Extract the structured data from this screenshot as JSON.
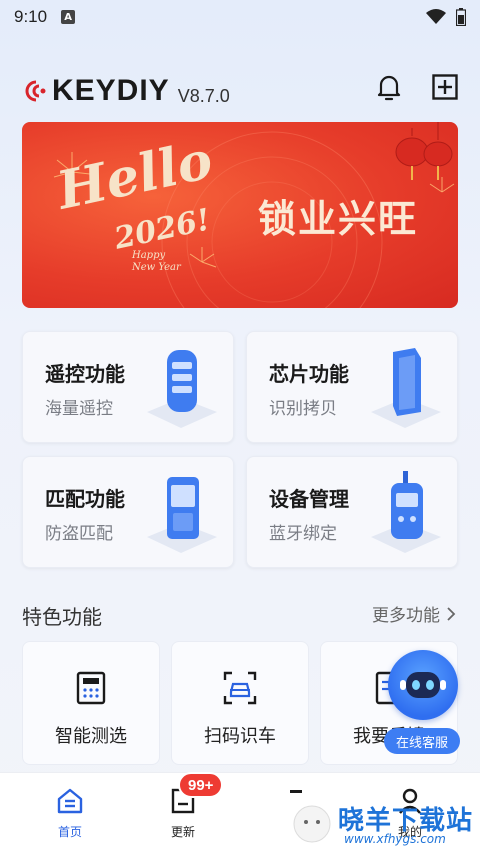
{
  "status_bar": {
    "time": "9:10",
    "notification_glyph": "A"
  },
  "header": {
    "brand": "KEYDIY",
    "version": "V8.7.0",
    "icons": [
      "bell-icon",
      "add-square-icon"
    ]
  },
  "banner": {
    "hello": "Hello",
    "year": "2026!",
    "happy_line1": "Happy",
    "happy_line2": "New Year",
    "slogan": "锁业兴旺"
  },
  "features": [
    {
      "title": "遥控功能",
      "subtitle": "海量遥控"
    },
    {
      "title": "芯片功能",
      "subtitle": "识别拷贝"
    },
    {
      "title": "匹配功能",
      "subtitle": "防盗匹配"
    },
    {
      "title": "设备管理",
      "subtitle": "蓝牙绑定"
    }
  ],
  "special": {
    "title": "特色功能",
    "more": "更多功能",
    "tools": [
      {
        "label": "智能测选",
        "icon": "calculator-icon"
      },
      {
        "label": "扫码识车",
        "icon": "scan-car-icon"
      },
      {
        "label": "我要反馈",
        "icon": "feedback-icon"
      }
    ]
  },
  "customer_service": {
    "label": "在线客服"
  },
  "tabbar": {
    "tabs": [
      {
        "label": "首页",
        "active": true
      },
      {
        "label": "更新",
        "badge": "99+"
      },
      {
        "label": ""
      },
      {
        "label": "我的"
      }
    ]
  },
  "watermark": {
    "title": "晓羊下载站",
    "url": "www.xfhygs.com"
  },
  "colors": {
    "accent": "#2a62e0",
    "banner_red": "#e63c2a",
    "badge_red": "#ee3b33",
    "cs_blue": "#3d7df3"
  }
}
